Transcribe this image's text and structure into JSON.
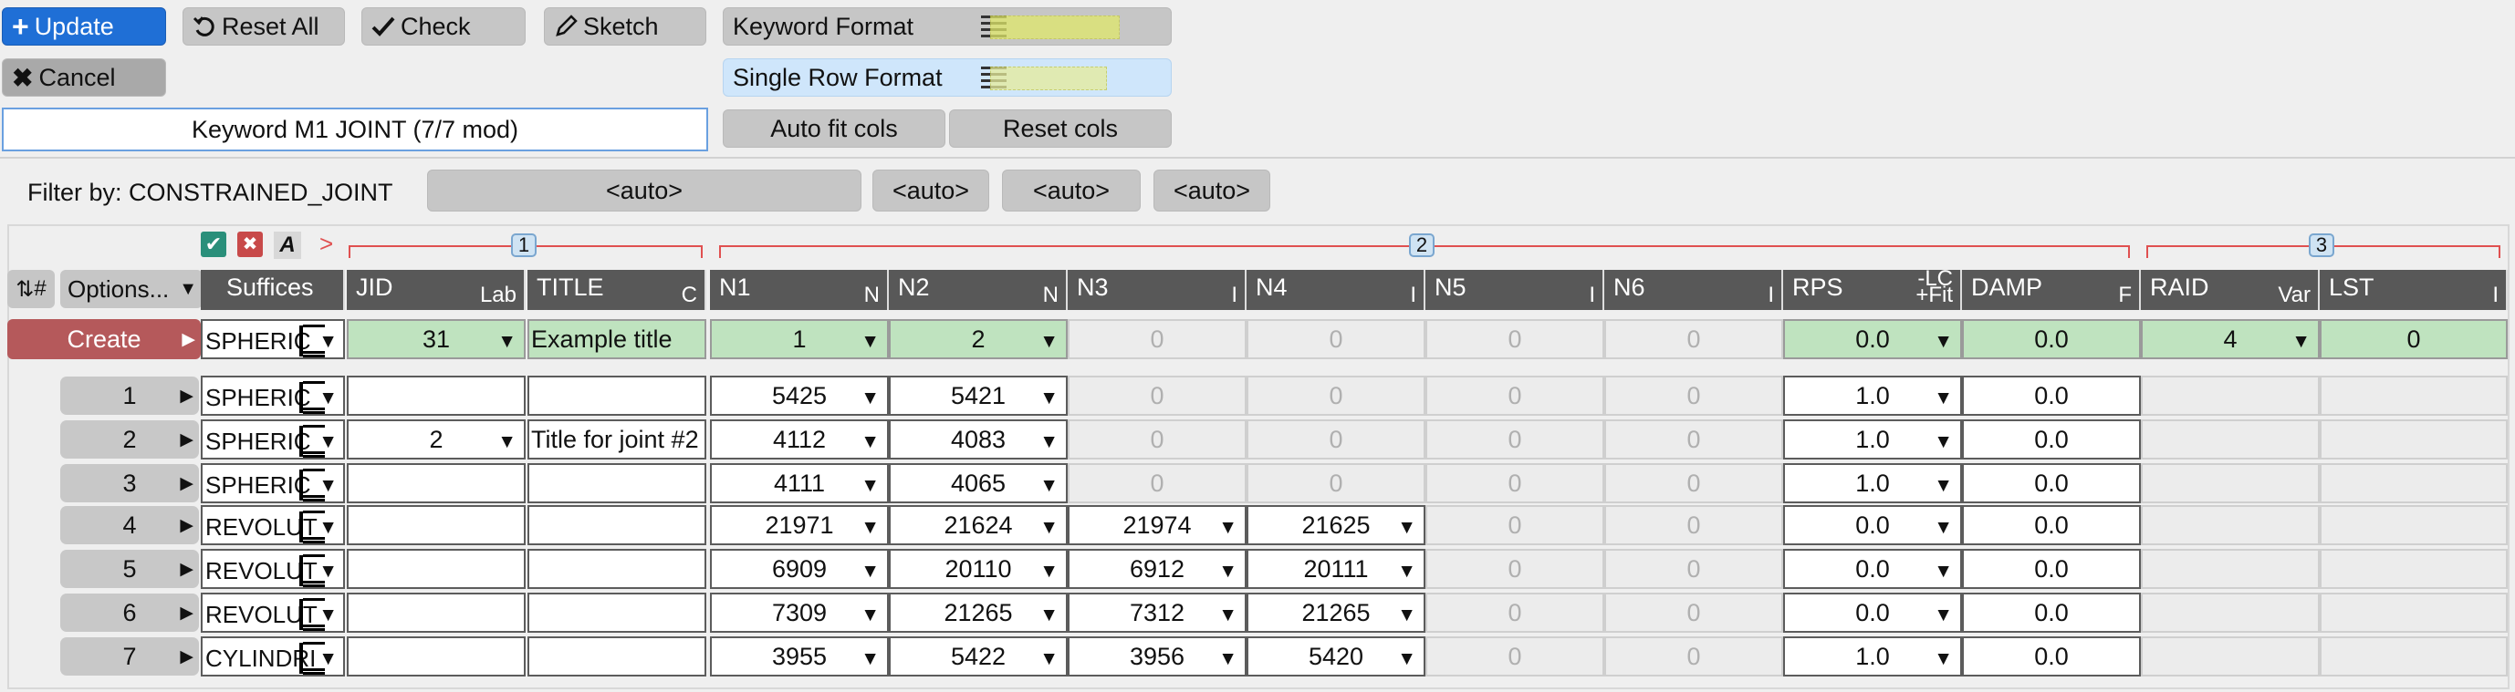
{
  "toolbar": {
    "update": "Update",
    "reset_all": "Reset All",
    "check": "Check",
    "sketch": "Sketch",
    "cancel": "Cancel",
    "keyword_format": "Keyword Format",
    "single_row_format": "Single Row Format",
    "auto_fit_cols": "Auto fit cols",
    "reset_cols": "Reset cols"
  },
  "keyword_title": "Keyword M1 JOINT (7/7 mod)",
  "filter": {
    "label": "Filter by: CONSTRAINED_JOINT",
    "fields": [
      "<auto>",
      "<auto>",
      "<auto>",
      "<auto>"
    ]
  },
  "groups": [
    "1",
    "2",
    "3"
  ],
  "table": {
    "row_num_header": "#",
    "options_label": "Options...",
    "columns": [
      {
        "name": "Suffices",
        "sub": ""
      },
      {
        "name": "JID",
        "sub": "Lab"
      },
      {
        "name": "TITLE",
        "sub": "C"
      },
      {
        "name": "N1",
        "sub": "N"
      },
      {
        "name": "N2",
        "sub": "N"
      },
      {
        "name": "N3",
        "sub": "I"
      },
      {
        "name": "N4",
        "sub": "I"
      },
      {
        "name": "N5",
        "sub": "I"
      },
      {
        "name": "N6",
        "sub": "I"
      },
      {
        "name": "RPS",
        "sub": "+Fit",
        "sub_top": "-LC"
      },
      {
        "name": "DAMP",
        "sub": "F"
      },
      {
        "name": "RAID",
        "sub": "Var"
      },
      {
        "name": "LST",
        "sub": "I"
      }
    ],
    "create_row": {
      "label": "Create",
      "suffix": "SPHERIC",
      "jid": "31",
      "title": "Example title",
      "n1": "1",
      "n2": "2",
      "n3": "0",
      "n4": "0",
      "n5": "0",
      "n6": "0",
      "rps": "0.0",
      "damp": "0.0",
      "raid": "4",
      "lst": "0"
    },
    "rows": [
      {
        "num": "1",
        "suffix": "SPHERIC",
        "jid": "",
        "title": "",
        "n1": "5425",
        "n2": "5421",
        "n3": "0",
        "n4": "0",
        "n5": "0",
        "n6": "0",
        "rps": "1.0",
        "damp": "0.0"
      },
      {
        "num": "2",
        "suffix": "SPHERIC",
        "jid": "2",
        "title": "Title for joint #2",
        "n1": "4112",
        "n2": "4083",
        "n3": "0",
        "n4": "0",
        "n5": "0",
        "n6": "0",
        "rps": "1.0",
        "damp": "0.0"
      },
      {
        "num": "3",
        "suffix": "SPHERIC",
        "jid": "",
        "title": "",
        "n1": "4111",
        "n2": "4065",
        "n3": "0",
        "n4": "0",
        "n5": "0",
        "n6": "0",
        "rps": "1.0",
        "damp": "0.0"
      },
      {
        "num": "4",
        "suffix": "REVOLUT",
        "jid": "",
        "title": "",
        "n1": "21971",
        "n2": "21624",
        "n3": "21974",
        "n4": "21625",
        "n5": "0",
        "n6": "0",
        "rps": "0.0",
        "damp": "0.0"
      },
      {
        "num": "5",
        "suffix": "REVOLUT",
        "jid": "",
        "title": "",
        "n1": "6909",
        "n2": "20110",
        "n3": "6912",
        "n4": "20111",
        "n5": "0",
        "n6": "0",
        "rps": "0.0",
        "damp": "0.0"
      },
      {
        "num": "6",
        "suffix": "REVOLUT",
        "jid": "",
        "title": "",
        "n1": "7309",
        "n2": "21265",
        "n3": "7312",
        "n4": "21265",
        "n5": "0",
        "n6": "0",
        "rps": "0.0",
        "damp": "0.0"
      },
      {
        "num": "7",
        "suffix": "CYLINDRI",
        "jid": "",
        "title": "",
        "n1": "3955",
        "n2": "5422",
        "n3": "3956",
        "n4": "5420",
        "n5": "0",
        "n6": "0",
        "rps": "1.0",
        "damp": "0.0"
      }
    ]
  },
  "colors": {
    "primary": "#1f6fd6",
    "create": "#b5595b",
    "valid_green": "#bfe3bf",
    "header": "#585858",
    "accent_blue": "#cfe6fb"
  }
}
